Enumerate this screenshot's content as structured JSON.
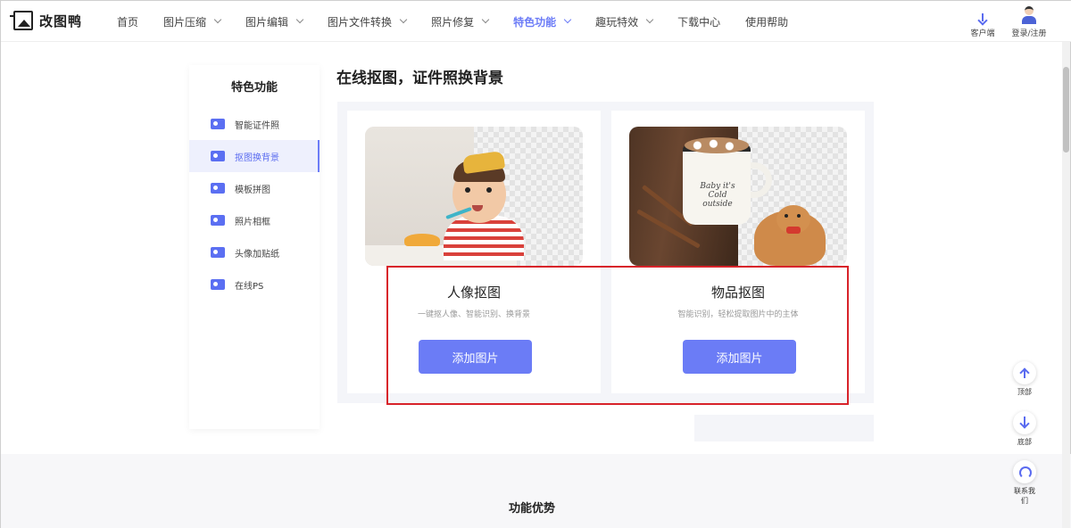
{
  "header": {
    "logo_text": "改图鸭",
    "nav": [
      {
        "label": "首页",
        "dropdown": false
      },
      {
        "label": "图片压缩",
        "dropdown": true
      },
      {
        "label": "图片编辑",
        "dropdown": true
      },
      {
        "label": "图片文件转换",
        "dropdown": true
      },
      {
        "label": "照片修复",
        "dropdown": true
      },
      {
        "label": "特色功能",
        "dropdown": true,
        "active": true
      },
      {
        "label": "趣玩特效",
        "dropdown": true
      },
      {
        "label": "下载中心",
        "dropdown": false
      },
      {
        "label": "使用帮助",
        "dropdown": false
      }
    ],
    "client_label": "客户端",
    "login_label": "登录/注册"
  },
  "sidebar": {
    "title": "特色功能",
    "items": [
      {
        "label": "智能证件照",
        "icon": "id-photo-icon"
      },
      {
        "label": "抠图换背景",
        "icon": "cutout-icon",
        "active": true
      },
      {
        "label": "模板拼图",
        "icon": "template-collage-icon"
      },
      {
        "label": "照片相框",
        "icon": "photo-frame-icon"
      },
      {
        "label": "头像加贴纸",
        "icon": "avatar-sticker-icon"
      },
      {
        "label": "在线PS",
        "icon": "online-ps-icon"
      }
    ]
  },
  "main": {
    "title": "在线抠图，证件照换背景",
    "cards": [
      {
        "title": "人像抠图",
        "desc": "一键抠人像、智能识别、换背景",
        "button": "添加图片"
      },
      {
        "title": "物品抠图",
        "desc": "智能识别，轻松提取图片中的主体",
        "button": "添加图片"
      }
    ],
    "mug_text": "Baby it's Cold outside"
  },
  "bottom": {
    "title": "功能优势"
  },
  "float": {
    "top_label": "顶部",
    "bottom_label": "底部",
    "contact_label": "联系我们"
  },
  "colors": {
    "accent": "#6b7cf6",
    "highlight": "#d8232a"
  }
}
